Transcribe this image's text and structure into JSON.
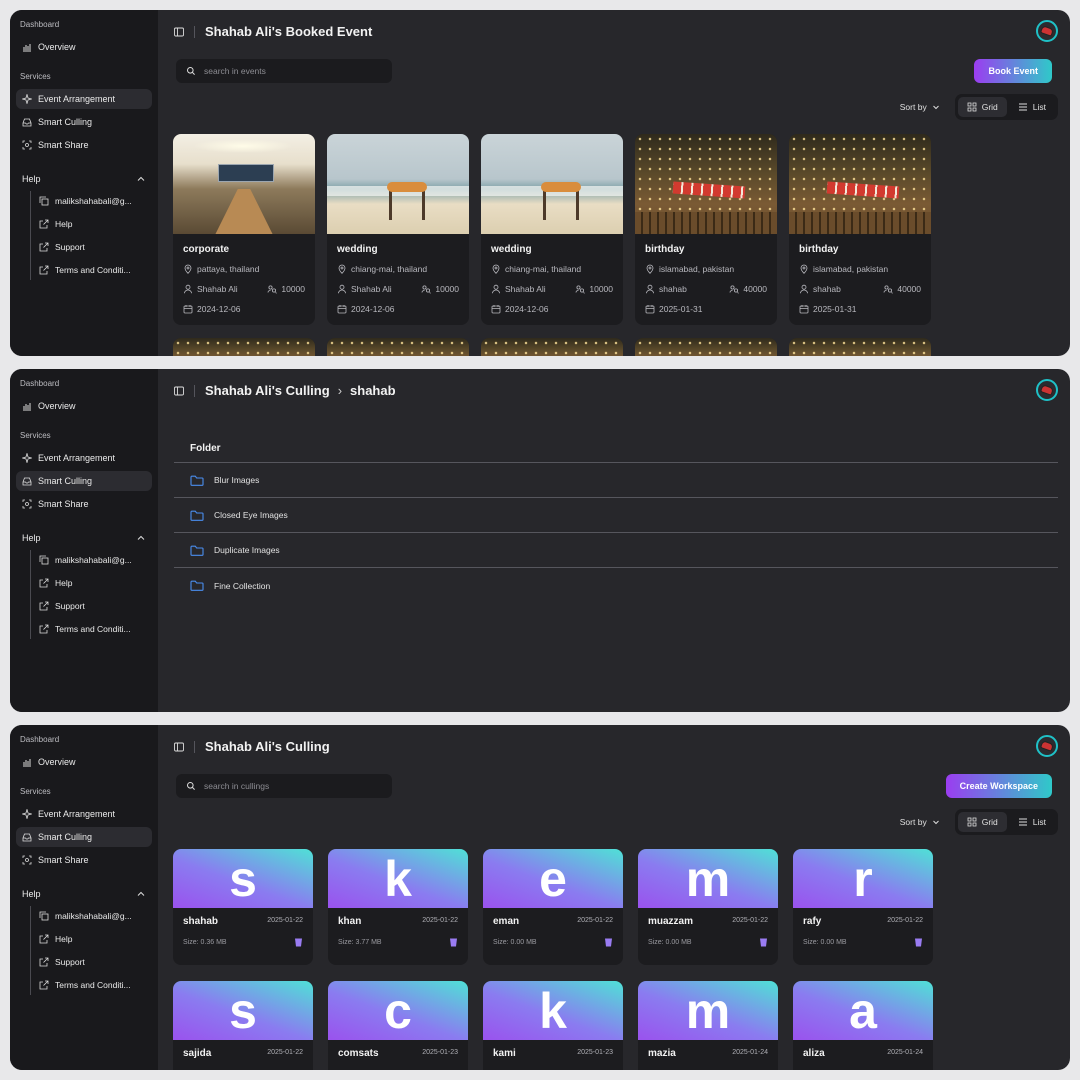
{
  "colors": {
    "accent_start": "#9b3df0",
    "accent_end": "#2fc9c9",
    "folder_icon": "#4a8ef0",
    "trash_icon": "#9a7cf2",
    "avatar_ring": "#1fc1c7"
  },
  "sidebar": {
    "dashboard_label": "Dashboard",
    "overview": "Overview",
    "services_label": "Services",
    "event_arrangement": "Event Arrangement",
    "smart_culling": "Smart Culling",
    "smart_share": "Smart Share",
    "help_label": "Help",
    "email": "malikshahabali@g...",
    "help": "Help",
    "support": "Support",
    "terms": "Terms and Conditi..."
  },
  "events_page": {
    "title": "Shahab Ali's Booked Event",
    "search_placeholder": "search in events",
    "book_button": "Book Event",
    "sort_label": "Sort by",
    "grid_label": "Grid",
    "list_label": "List",
    "events": [
      {
        "title": "corporate",
        "location": "pattaya, thailand",
        "host": "Shahab Ali",
        "guests": "10000",
        "date": "2024-12-06",
        "image": "conference-room"
      },
      {
        "title": "wedding",
        "location": "chiang-mai, thailand",
        "host": "Shahab Ali",
        "guests": "10000",
        "date": "2024-12-06",
        "image": "beach-wedding"
      },
      {
        "title": "wedding",
        "location": "chiang-mai, thailand",
        "host": "Shahab Ali",
        "guests": "10000",
        "date": "2024-12-06",
        "image": "beach-wedding"
      },
      {
        "title": "birthday",
        "location": "islamabad, pakistan",
        "host": "shahab",
        "guests": "40000",
        "date": "2025-01-31",
        "image": "birthday-party"
      },
      {
        "title": "birthday",
        "location": "islamabad, pakistan",
        "host": "shahab",
        "guests": "40000",
        "date": "2025-01-31",
        "image": "birthday-party"
      }
    ]
  },
  "folder_page": {
    "title": "Shahab Ali's Culling",
    "crumb_separator": "›",
    "crumb": "shahab",
    "folder_header": "Folder",
    "folders": [
      "Blur Images",
      "Closed Eye Images",
      "Duplicate Images",
      "Fine Collection"
    ]
  },
  "culling_page": {
    "title": "Shahab Ali's Culling",
    "search_placeholder": "search in cullings",
    "create_button": "Create Workspace",
    "sort_label": "Sort by",
    "grid_label": "Grid",
    "list_label": "List",
    "size_prefix": "Size:",
    "workspaces_row1": [
      {
        "letter": "s",
        "name": "shahab",
        "date": "2025-01-22",
        "size": "Size: 0.36 MB"
      },
      {
        "letter": "k",
        "name": "khan",
        "date": "2025-01-22",
        "size": "Size: 3.77 MB"
      },
      {
        "letter": "e",
        "name": "eman",
        "date": "2025-01-22",
        "size": "Size: 0.00 MB"
      },
      {
        "letter": "m",
        "name": "muazzam",
        "date": "2025-01-22",
        "size": "Size: 0.00 MB"
      },
      {
        "letter": "r",
        "name": "rafy",
        "date": "2025-01-22",
        "size": "Size: 0.00 MB"
      }
    ],
    "workspaces_row2": [
      {
        "letter": "s",
        "name": "sajida",
        "date": "2025-01-22"
      },
      {
        "letter": "c",
        "name": "comsats",
        "date": "2025-01-23"
      },
      {
        "letter": "k",
        "name": "kami",
        "date": "2025-01-23"
      },
      {
        "letter": "m",
        "name": "mazia",
        "date": "2025-01-24"
      },
      {
        "letter": "a",
        "name": "aliza",
        "date": "2025-01-24"
      }
    ]
  }
}
